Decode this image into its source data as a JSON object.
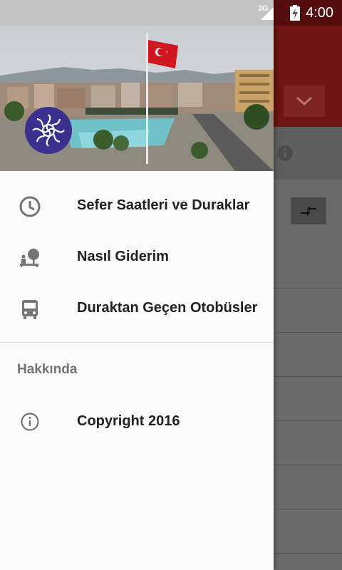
{
  "status_bar": {
    "network": "3G",
    "time": "4:00"
  },
  "drawer": {
    "menu": [
      {
        "label": "Sefer Saatleri ve Duraklar",
        "icon": "clock-icon"
      },
      {
        "label": "Nasıl Giderim",
        "icon": "directions-icon"
      },
      {
        "label": "Duraktan Geçen Otobüsler",
        "icon": "bus-icon"
      }
    ],
    "section_title": "Hakkında",
    "about": {
      "label": "Copyright 2016",
      "icon": "info-icon"
    }
  },
  "colors": {
    "app_bar": "#6e1414",
    "drawer_bg": "#fafafa",
    "logo_bg": "#3b2f8f"
  }
}
